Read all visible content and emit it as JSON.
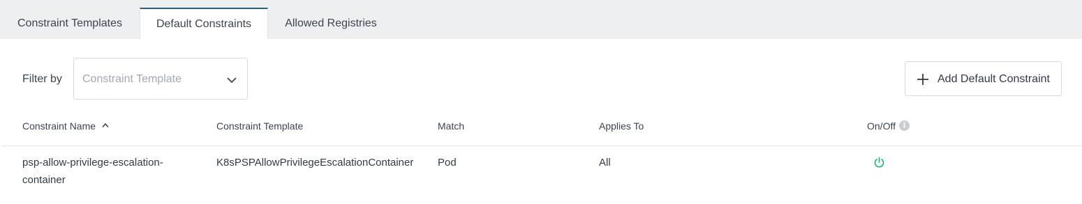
{
  "tabs": [
    {
      "label": "Constraint Templates",
      "active": false
    },
    {
      "label": "Default Constraints",
      "active": true
    },
    {
      "label": "Allowed Registries",
      "active": false
    }
  ],
  "filter": {
    "label": "Filter by",
    "placeholder": "Constraint Template",
    "icon": "chevron-down-icon"
  },
  "add_button": {
    "label": "Add Default Constraint",
    "icon": "plus-icon"
  },
  "table": {
    "columns": {
      "name": "Constraint Name",
      "template": "Constraint Template",
      "match": "Match",
      "applies_to": "Applies To",
      "on_off": "On/Off"
    },
    "sort": {
      "column": "name",
      "direction": "ascending",
      "icon": "chevron-up-icon"
    },
    "on_off_info_icon": "info-icon",
    "rows": [
      {
        "name": "psp-allow-privilege-escalation-container",
        "template": "K8sPSPAllowPrivilegeEscalationContainer",
        "match": "Pod",
        "applies_to": "All",
        "enabled": true,
        "toggle_icon": "power-icon"
      }
    ]
  },
  "colors": {
    "active_tab_border": "#2d5f82",
    "power_on": "#27b77a",
    "tabbar_bg": "#eeeff1"
  }
}
